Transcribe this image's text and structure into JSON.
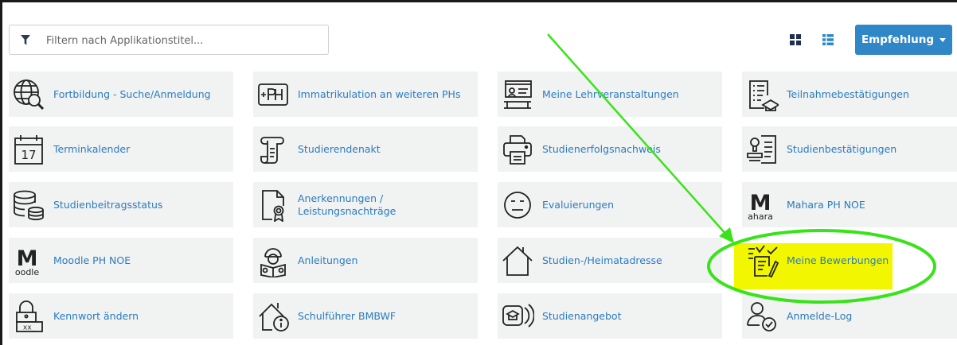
{
  "filter": {
    "placeholder": "Filtern nach Applikationstitel..."
  },
  "toolbar": {
    "tile_view_icon": "grid-view-icon",
    "list_view_icon": "list-view-icon",
    "recommend_label": "Empfehlung"
  },
  "tiles": [
    {
      "label": "Fortbildung - Suche/Anmeldung",
      "icon": "globe-search-icon"
    },
    {
      "label": "Immatrikulation an weiteren PHs",
      "icon": "ph-plus-icon"
    },
    {
      "label": "Meine Lehrveranstaltungen",
      "icon": "lecture-board-icon"
    },
    {
      "label": "Teilnahmebestätigungen",
      "icon": "certificate-document-icon"
    },
    {
      "label": "Terminkalender",
      "icon": "calendar-17-icon"
    },
    {
      "label": "Studierendenakt",
      "icon": "scroll-icon"
    },
    {
      "label": "Studienerfolgsnachweis",
      "icon": "printer-icon"
    },
    {
      "label": "Studienbestätigungen",
      "icon": "stamp-document-icon"
    },
    {
      "label": "Studienbeitragsstatus",
      "icon": "coins-database-icon"
    },
    {
      "label": "Anerkennungen / Leistungsnachträge",
      "icon": "document-badge-icon"
    },
    {
      "label": "Evaluierungen",
      "icon": "face-neutral-icon"
    },
    {
      "label": "Mahara PH NOE",
      "icon": "mahara-logo-icon"
    },
    {
      "label": "Moodle PH NOE",
      "icon": "moodle-logo-icon"
    },
    {
      "label": "Anleitungen",
      "icon": "reading-person-icon"
    },
    {
      "label": "Studien-/Heimatadresse",
      "icon": "house-outline-icon"
    },
    {
      "label": "Meine Bewerbungen",
      "icon": "application-pen-icon"
    },
    {
      "label": "Kennwort ändern",
      "icon": "lock-password-icon"
    },
    {
      "label": "Schulführer BMBWF",
      "icon": "school-info-icon"
    },
    {
      "label": "Studienangebot",
      "icon": "study-offer-icon"
    },
    {
      "label": "Anmelde-Log",
      "icon": "user-check-icon"
    }
  ],
  "annotation": {
    "color": "#39e31a",
    "highlight_color": "#f2f700"
  }
}
